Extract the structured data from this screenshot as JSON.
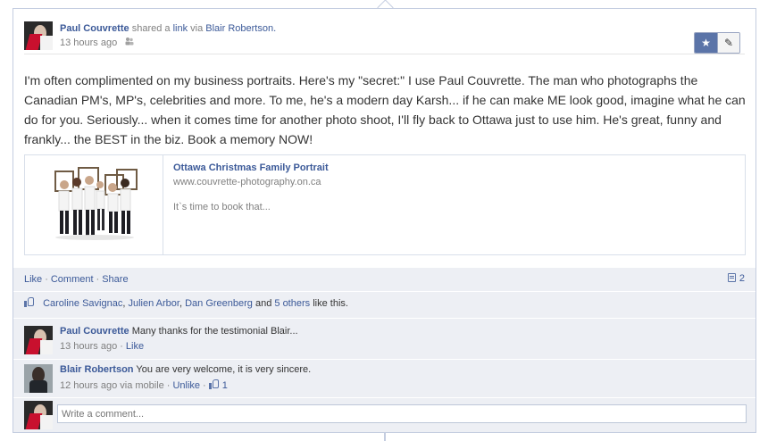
{
  "post": {
    "author": "Paul Couvrette",
    "shared_text": "shared a",
    "link_word": "link",
    "via_text": "via",
    "via_name": "Blair Robertson.",
    "time": "13 hours ago",
    "audience_icon": "people-icon",
    "message": "I'm often complimented on my business portraits. Here's my \"secret:\" I use Paul Couvrette. The man who photographs the Canadian PM's, MP's, celebrities and more. To me, he's a modern day Karsh... if he can make ME look good, imagine what he can do for you. Seriously... when it comes time for another photo shoot, I'll fly back to Ottawa just to use him. He's great, funny and frankly... the BEST in the biz. Book a memory NOW!"
  },
  "toolbar": {
    "star_icon": "star-icon",
    "edit_icon": "pencil-icon"
  },
  "share": {
    "title": "Ottawa Christmas Family Portrait",
    "url": "www.couvrette-photography.on.ca",
    "description": "It`s time to book that..."
  },
  "ufi": {
    "like": "Like",
    "comment": "Comment",
    "share": "Share",
    "comment_count": "2",
    "likers": [
      "Caroline Savignac",
      "Julien Arbor",
      "Dan Greenberg"
    ],
    "likes_and": "and",
    "likes_others": "5 others",
    "likes_suffix": "like this."
  },
  "comments": [
    {
      "author": "Paul Couvrette",
      "text": "Many thanks for the testimonial Blair...",
      "time": "13 hours ago",
      "like": "Like"
    },
    {
      "author": "Blair Robertson",
      "text": "You are very welcome, it is very sincere.",
      "time": "12 hours ago via mobile",
      "unlike": "Unlike",
      "like_count": "1"
    }
  ],
  "composer": {
    "placeholder": "Write a comment..."
  },
  "colors": {
    "link": "#3b5998",
    "ufi_bg": "#edeff4",
    "border": "#c4cde0"
  }
}
